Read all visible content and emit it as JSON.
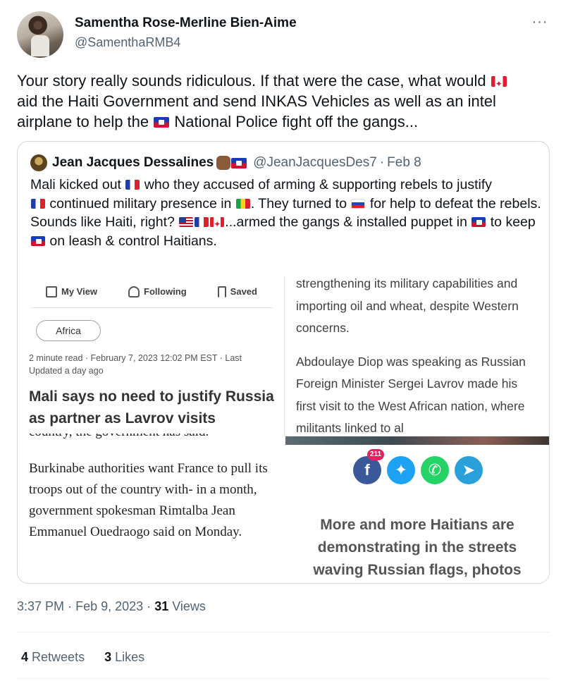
{
  "author": {
    "name": "Samentha Rose-Merline Bien-Aime",
    "handle": "@SamenthaRMB4"
  },
  "tweet": {
    "text_1": "Your story really sounds ridiculous. If that were the case, what would ",
    "text_2": " aid the Haiti Government and send INKAS Vehicles as well as an intel airplane to help the ",
    "text_3": " National Police fight off the gangs..."
  },
  "quote": {
    "name": "Jean Jacques Dessalines",
    "handle": "@JeanJacquesDes7",
    "sep": "·",
    "date": "Feb 8",
    "l1a": "Mali kicked out ",
    "l1b": " who they accused of arming & supporting rebels to justify ",
    "l1c": " continued military presence in ",
    "l1d": ". They turned to ",
    "l1e": " for help to defeat the rebels.",
    "l2a": "Sounds like Haiti, right? ",
    "l2b": "...armed the gangs & installed puppet in ",
    "l2c": " to keep ",
    "l2d": " on leash & control Haitians."
  },
  "media": {
    "toolbar": {
      "my_view": "My View",
      "following": "Following",
      "saved": "Saved"
    },
    "tag": "Africa",
    "meta": "2 minute read · February 7, 2023 12:02 PM EST · Last Updated a day ago",
    "headline": "Mali says no need to justify Russia as partner as Lavrov visits",
    "serif_cut": "country, the government has said.",
    "serif_para": "Burkinabe authorities want France to pull its troops out of the country with- in a month, government spokesman Rimtalba Jean Emmanuel Ouedraogo said on Monday.",
    "reuters_p1": "strengthening its military capabilities and importing oil and wheat, despite Western concerns.",
    "reuters_p2": "Abdoulaye Diop was speaking as Russian Foreign Minister Sergei Lavrov made his first visit to the West African nation, where militants linked to al",
    "share_badge": "211",
    "share_headline": "More and more Haitians are demonstrating in the streets waving Russian flags, photos"
  },
  "footer": {
    "time": "3:37 PM",
    "sep": "·",
    "date": "Feb 9, 2023",
    "views_count": "31",
    "views_label": "Views",
    "retweets_count": "4",
    "retweets_label": "Retweets",
    "likes_count": "3",
    "likes_label": "Likes"
  },
  "icons": {
    "more": "more-icon",
    "flags": [
      "flag-canada-icon",
      "flag-haiti-icon",
      "flag-france-icon",
      "flag-mali-icon",
      "flag-russia-icon",
      "flag-usa-icon"
    ]
  }
}
